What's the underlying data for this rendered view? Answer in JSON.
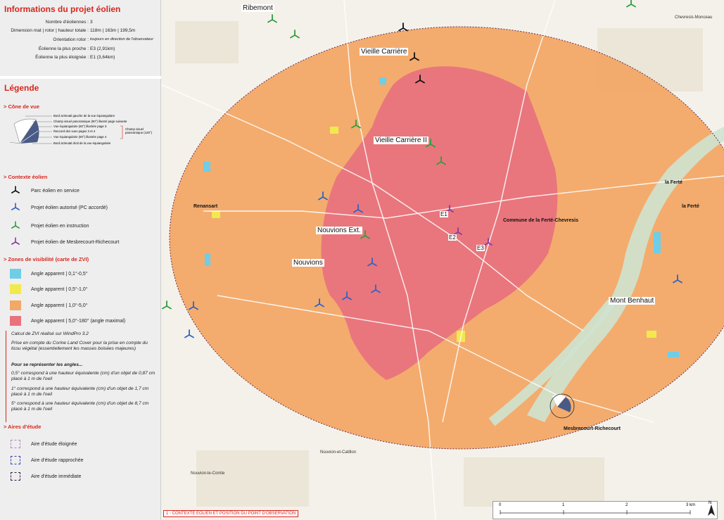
{
  "info": {
    "title": "Informations du projet éolien",
    "rows": [
      {
        "label": "Nombre d'éoliennes :",
        "value": "3"
      },
      {
        "label": "Dimension mat | rotor | hauteur totale :",
        "value": "118m | 163m | 199,5m"
      },
      {
        "label": "Orientation rotor :",
        "value": "toujours en direction de l'observateur"
      },
      {
        "label": "Éolienne la plus proche :",
        "value": "E3 (2,91km)"
      },
      {
        "label": "Éolienne la plus éloignée :",
        "value": "E1 (3,64km)"
      }
    ]
  },
  "legend": {
    "title": "Légende",
    "cone": {
      "title": "> Cône de vue",
      "labels": [
        "Bord azimutal gauche de la vue équiangulaire",
        "Champ visuel panoramique (90°) illustré page suivante",
        "Vue équiangulaire (60°) illustrée page 3",
        "Raccord des vues pages 3 et 4",
        "Vue équiangulaire (60°) illustrée page 4",
        "Bord azimutal droit de la vue équiangulaire"
      ],
      "bracket_label": "Champ visuel panoramique (120°)"
    },
    "eolien": {
      "title": "> Contexte éolien",
      "items": [
        {
          "label": "Parc éolien en service",
          "color": "#111111"
        },
        {
          "label": "Projet éolien autorisé (PC accordé)",
          "color": "#2f62c4"
        },
        {
          "label": "Projet éolien en instruction",
          "color": "#2e9e3e"
        },
        {
          "label": "Projet éolien de Mesbrecourt-Richecourt",
          "color": "#8b3a9e"
        }
      ]
    },
    "zvi": {
      "title": "> Zones de visibilité (carte de ZVI)",
      "items": [
        {
          "label": "Angle apparent | 0,1°-0,5°",
          "color": "#6fcde8"
        },
        {
          "label": "Angle apparent | 0,5°-1,0°",
          "color": "#f2e94e"
        },
        {
          "label": "Angle apparent | 1,0°-5,0°",
          "color": "#f2a867"
        },
        {
          "label": "Angle apparent | 5,0°-180° (angle maximal)",
          "color": "#e8737d"
        }
      ]
    },
    "notes": [
      "Calcul de ZVI réalisé sur WindPro 3.2",
      "Prise en compte du Corine Land Cover pour la prise en compte du tissu végétal (essentiellement les masses boisées majeures)",
      "Pour se représenter les angles...",
      "0,5° correspond à une hauteur équivalente (cm) d'un objet de 0,87 cm placé à 1 m de l'oeil",
      "1° correspond à une hauteur équivalente (cm) d'un objet de 1,7 cm placé à 1 m de l'oeil",
      "5° correspond à une hauteur équivalente (cm) d'un objet de 8,7 cm placé à 1 m de l'oeil"
    ],
    "aires": {
      "title": "> Aires d'étude",
      "items": [
        {
          "label": "Aire d'étude éloignée",
          "color": "#b084c9"
        },
        {
          "label": "Aire d'étude rapprochée",
          "color": "#3b3fb0"
        },
        {
          "label": "Aire d'étude immédiate",
          "color": "#3d1f4a"
        }
      ]
    }
  },
  "map": {
    "places": {
      "ribemont": "Ribemont",
      "vieille_carriere": "Vieille Carrière",
      "vieille_carriere_2": "Vieille Carrière II",
      "nouvions_ext": "Nouvions Ext.",
      "nouvions": "Nouvions",
      "mont_benhaut": "Mont Benhaut",
      "la_ferte": "la Ferté",
      "commune": "Commune de la Ferté-Chevresis",
      "mesbrecourt": "Mesbrecourt-Richecourt",
      "renansart": "Renansart",
      "chevresis_monceau": "Chevresis-Monceau",
      "nouvion_catillon": "Nouvion-et-Catillon",
      "nouvion_comte": "Nouvion-le-Comte"
    },
    "turbines": {
      "e1": "E1",
      "e2": "E2",
      "e3": "E3"
    },
    "scale": {
      "t0": "0",
      "t1": "1",
      "t2": "2",
      "t3": "3 km"
    },
    "north": "N"
  },
  "caption": "1 - CONTEXTE ÉOLIEN ET POSITION DU POINT D'OBSERVATION"
}
